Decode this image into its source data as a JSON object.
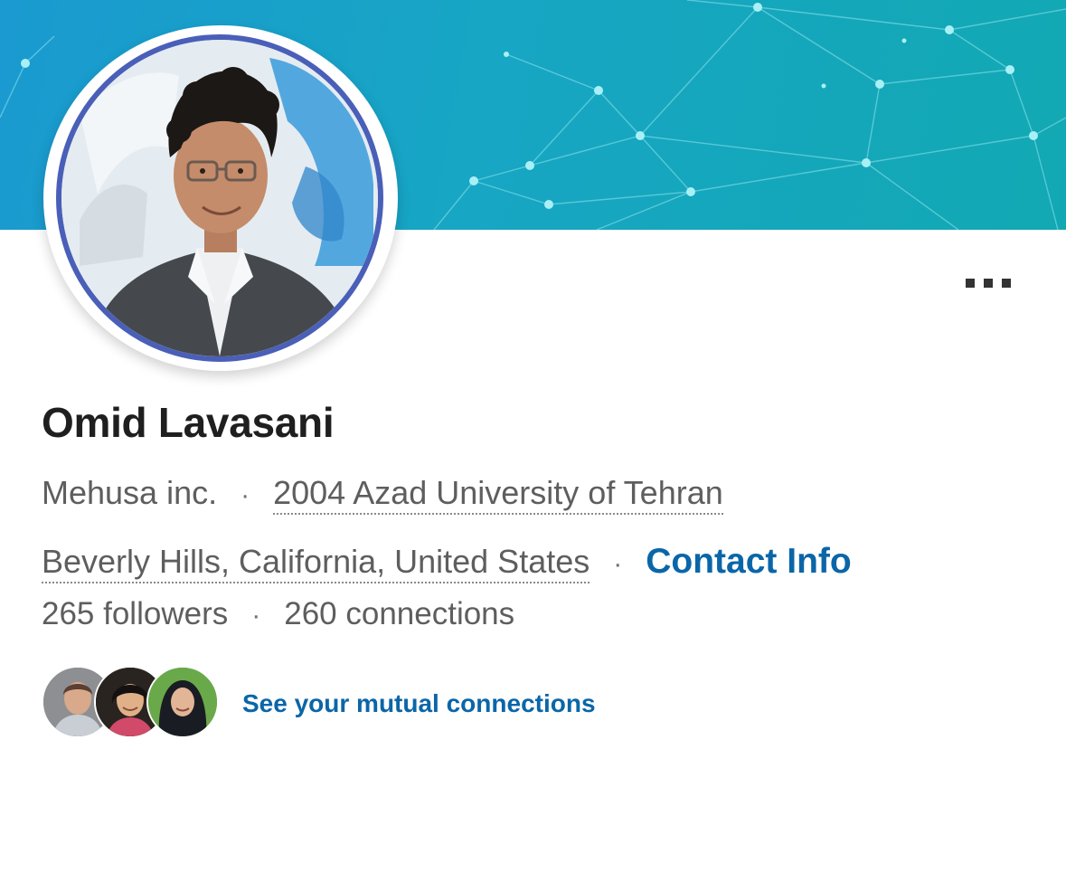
{
  "profile": {
    "name": "Omid Lavasani",
    "company": "Mehusa inc.",
    "education": "2004 Azad University of Tehran",
    "location": "Beverly Hills, California, United States",
    "contact_info_label": "Contact Info",
    "followers": "265 followers",
    "connections": "260 connections",
    "separator": "·"
  },
  "mutual": {
    "link_label": "See your mutual connections"
  },
  "colors": {
    "banner": "#17a6c4",
    "avatar_ring": "#4a5fb8",
    "link": "#0a66a8",
    "name_text": "#1f1f1f",
    "secondary_text": "#5e5e5e"
  },
  "icons": {
    "more": "more-horizontal-icon"
  }
}
